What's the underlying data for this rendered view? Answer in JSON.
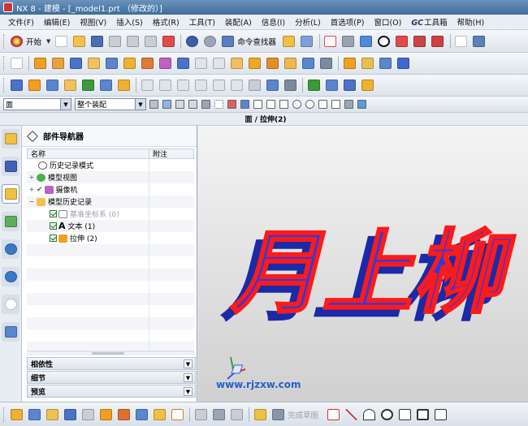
{
  "window": {
    "title": "NX 8 - 建模 - [_model1.prt （修改的）]"
  },
  "menu": [
    "文件(F)",
    "编辑(E)",
    "视图(V)",
    "插入(S)",
    "格式(R)",
    "工具(T)",
    "装配(A)",
    "信息(I)",
    "分析(L)",
    "首选项(P)",
    "窗口(O)",
    "工具箱",
    "帮助(H)"
  ],
  "menu_gc_prefix": "GC",
  "toolbar": {
    "start_label": "开始",
    "command_finder_label": "命令查找器"
  },
  "selection_bar": {
    "filter_value": "面",
    "scope_value": "整个装配"
  },
  "status_caption": "面 / 拉伸(2)",
  "navigator": {
    "title": "部件导航器",
    "col_name": "名称",
    "col_note": "附注",
    "items": [
      {
        "label": "历史记录模式",
        "icon": "clock-icon"
      },
      {
        "label": "模型视图",
        "icon": "model-views-icon"
      },
      {
        "label": "摄像机",
        "icon": "camera-icon"
      },
      {
        "label": "模型历史记录",
        "icon": "folder-icon"
      },
      {
        "label": "基准坐标系 (0)",
        "icon": "datum-csys-icon"
      },
      {
        "label": "文本 (1)",
        "icon": "text-icon",
        "glyph": "A"
      },
      {
        "label": "拉伸 (2)",
        "icon": "extrude-icon"
      }
    ],
    "sections": [
      "相依性",
      "细节",
      "预览"
    ]
  },
  "graphics": {
    "model_text": "月上柳",
    "watermark": "www.rjzxw.com",
    "colors": {
      "extrude_face": "#1f2fd6",
      "edge_highlight": "#ff1a1a"
    }
  },
  "bottom_toolbar": {
    "finish_sketch_label": "完成草图"
  }
}
